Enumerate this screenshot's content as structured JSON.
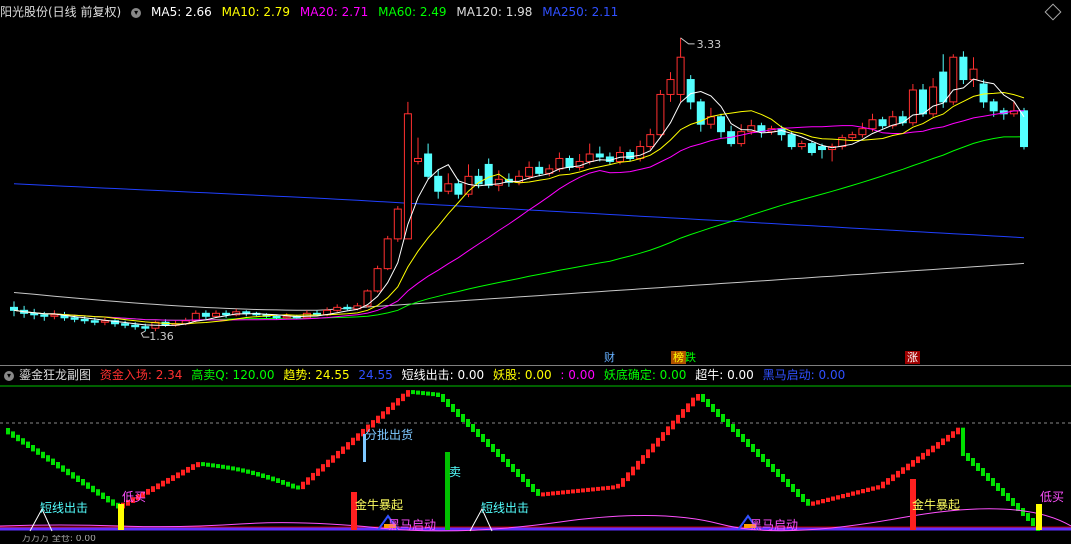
{
  "header": {
    "stock_name": "阳光股份(日线 前复权)",
    "ma": [
      {
        "label": "MA5: 2.66",
        "color": "#ffffff"
      },
      {
        "label": "MA10: 2.79",
        "color": "#ffff00"
      },
      {
        "label": "MA20: 2.71",
        "color": "#ff00ff"
      },
      {
        "label": "MA60: 2.49",
        "color": "#00ff00"
      },
      {
        "label": "MA120: 1.98",
        "color": "#dddddd"
      },
      {
        "label": "MA250: 2.11",
        "color": "#3050ff"
      }
    ]
  },
  "main": {
    "high_label": "3.33",
    "low_label": "1.36",
    "events": [
      {
        "label": "财",
        "color": "#66b0ff",
        "bg": "#000"
      },
      {
        "label": "榜",
        "color": "#ffff00",
        "bg": "#b05000"
      },
      {
        "label": "跌",
        "color": "#00ff00",
        "bg": "#000"
      },
      {
        "label": "涨",
        "color": "#ffffff",
        "bg": "#a00000"
      }
    ]
  },
  "sub": {
    "title": "鎏金狂龙副图",
    "items": [
      {
        "label": "资金入场: 2.34",
        "color": "#ff3030"
      },
      {
        "label": "高卖Q: 120.00",
        "color": "#00ff00"
      },
      {
        "label": "趋势: 24.55",
        "color": "#ffff00"
      },
      {
        "label": "24.55",
        "color": "#3050ff"
      },
      {
        "label": "短线出击: 0.00",
        "color": "#ffffff"
      },
      {
        "label": "妖股: 0.00",
        "color": "#ffff00"
      },
      {
        "label": ": 0.00",
        "color": "#ff00ff"
      },
      {
        "label": "妖底确定: 0.00",
        "color": "#00ff00"
      },
      {
        "label": "超牛: 0.00",
        "color": "#ffffff"
      },
      {
        "label": "黑马启动: 0.00",
        "color": "#3050ff"
      }
    ],
    "signals": {
      "short_out": "短线出击",
      "low_buy": "低买",
      "batch_sell": "分批出货",
      "sell": "卖",
      "bull_burst": "金牛暴起",
      "dark_horse": "黑马启动"
    }
  },
  "bottom": {
    "text": "万万万  全仓: 0.00"
  },
  "colors": {
    "up": "#ff3030",
    "down": "#54ffff",
    "ma5": "#ffffff",
    "ma10": "#ffff00",
    "ma20": "#ff00ff",
    "ma60": "#00ff00",
    "ma120": "#c8c8c8",
    "ma250": "#2040ff"
  },
  "chart_data": {
    "type": "candlestick",
    "ylim": [
      1.2,
      3.45
    ],
    "candles": [
      [
        1.52,
        1.5,
        1.56,
        1.46
      ],
      [
        1.5,
        1.48,
        1.53,
        1.45
      ],
      [
        1.48,
        1.47,
        1.51,
        1.44
      ],
      [
        1.47,
        1.46,
        1.49,
        1.43
      ],
      [
        1.46,
        1.47,
        1.5,
        1.44
      ],
      [
        1.47,
        1.45,
        1.49,
        1.43
      ],
      [
        1.45,
        1.44,
        1.47,
        1.42
      ],
      [
        1.44,
        1.43,
        1.46,
        1.41
      ],
      [
        1.43,
        1.42,
        1.45,
        1.4
      ],
      [
        1.42,
        1.43,
        1.45,
        1.4
      ],
      [
        1.43,
        1.41,
        1.44,
        1.39
      ],
      [
        1.41,
        1.4,
        1.43,
        1.38
      ],
      [
        1.4,
        1.39,
        1.42,
        1.37
      ],
      [
        1.39,
        1.38,
        1.41,
        1.36
      ],
      [
        1.38,
        1.42,
        1.43,
        1.36
      ],
      [
        1.42,
        1.4,
        1.44,
        1.39
      ],
      [
        1.4,
        1.41,
        1.43,
        1.39
      ],
      [
        1.41,
        1.43,
        1.45,
        1.4
      ],
      [
        1.43,
        1.48,
        1.5,
        1.42
      ],
      [
        1.48,
        1.46,
        1.5,
        1.44
      ],
      [
        1.46,
        1.48,
        1.5,
        1.45
      ],
      [
        1.48,
        1.47,
        1.5,
        1.45
      ],
      [
        1.47,
        1.49,
        1.51,
        1.46
      ],
      [
        1.49,
        1.48,
        1.5,
        1.46
      ],
      [
        1.48,
        1.47,
        1.49,
        1.46
      ],
      [
        1.47,
        1.46,
        1.48,
        1.45
      ],
      [
        1.46,
        1.45,
        1.47,
        1.44
      ],
      [
        1.45,
        1.46,
        1.48,
        1.44
      ],
      [
        1.46,
        1.45,
        1.47,
        1.44
      ],
      [
        1.45,
        1.48,
        1.5,
        1.45
      ],
      [
        1.48,
        1.47,
        1.5,
        1.46
      ],
      [
        1.47,
        1.5,
        1.52,
        1.46
      ],
      [
        1.5,
        1.52,
        1.54,
        1.49
      ],
      [
        1.52,
        1.51,
        1.54,
        1.5
      ],
      [
        1.51,
        1.53,
        1.55,
        1.5
      ],
      [
        1.53,
        1.63,
        1.64,
        1.52
      ],
      [
        1.63,
        1.78,
        1.8,
        1.62
      ],
      [
        1.78,
        1.98,
        2.0,
        1.77
      ],
      [
        1.98,
        2.18,
        2.2,
        1.96
      ],
      [
        1.98,
        2.82,
        2.9,
        1.98
      ],
      [
        2.5,
        2.52,
        2.66,
        2.48
      ],
      [
        2.55,
        2.4,
        2.62,
        2.38
      ],
      [
        2.4,
        2.3,
        2.45,
        2.25
      ],
      [
        2.3,
        2.35,
        2.42,
        2.28
      ],
      [
        2.35,
        2.28,
        2.38,
        2.25
      ],
      [
        2.28,
        2.4,
        2.48,
        2.26
      ],
      [
        2.4,
        2.35,
        2.45,
        2.32
      ],
      [
        2.48,
        2.34,
        2.52,
        2.32
      ],
      [
        2.34,
        2.38,
        2.44,
        2.3
      ],
      [
        2.38,
        2.36,
        2.42,
        2.33
      ],
      [
        2.36,
        2.4,
        2.44,
        2.34
      ],
      [
        2.4,
        2.46,
        2.5,
        2.38
      ],
      [
        2.46,
        2.42,
        2.5,
        2.4
      ],
      [
        2.42,
        2.45,
        2.48,
        2.4
      ],
      [
        2.45,
        2.52,
        2.56,
        2.43
      ],
      [
        2.52,
        2.46,
        2.54,
        2.44
      ],
      [
        2.46,
        2.5,
        2.55,
        2.44
      ],
      [
        2.5,
        2.55,
        2.62,
        2.48
      ],
      [
        2.55,
        2.53,
        2.6,
        2.5
      ],
      [
        2.53,
        2.5,
        2.56,
        2.48
      ],
      [
        2.5,
        2.56,
        2.6,
        2.48
      ],
      [
        2.56,
        2.52,
        2.58,
        2.5
      ],
      [
        2.52,
        2.6,
        2.64,
        2.5
      ],
      [
        2.6,
        2.68,
        2.72,
        2.58
      ],
      [
        2.68,
        2.95,
        2.98,
        2.66
      ],
      [
        2.95,
        3.05,
        3.1,
        2.9
      ],
      [
        2.95,
        3.2,
        3.33,
        2.9
      ],
      [
        3.05,
        2.9,
        3.08,
        2.85
      ],
      [
        2.9,
        2.75,
        2.92,
        2.7
      ],
      [
        2.75,
        2.8,
        2.86,
        2.72
      ],
      [
        2.8,
        2.7,
        2.82,
        2.66
      ],
      [
        2.7,
        2.62,
        2.74,
        2.6
      ],
      [
        2.62,
        2.7,
        2.75,
        2.6
      ],
      [
        2.7,
        2.74,
        2.78,
        2.68
      ],
      [
        2.74,
        2.7,
        2.76,
        2.66
      ],
      [
        2.7,
        2.72,
        2.74,
        2.68
      ],
      [
        2.72,
        2.68,
        2.74,
        2.64
      ],
      [
        2.68,
        2.6,
        2.7,
        2.58
      ],
      [
        2.6,
        2.62,
        2.64,
        2.58
      ],
      [
        2.62,
        2.56,
        2.64,
        2.54
      ],
      [
        2.6,
        2.58,
        2.62,
        2.52
      ],
      [
        2.58,
        2.6,
        2.62,
        2.5
      ],
      [
        2.6,
        2.66,
        2.68,
        2.58
      ],
      [
        2.66,
        2.68,
        2.7,
        2.64
      ],
      [
        2.68,
        2.72,
        2.76,
        2.66
      ],
      [
        2.72,
        2.78,
        2.82,
        2.7
      ],
      [
        2.78,
        2.74,
        2.8,
        2.72
      ],
      [
        2.74,
        2.8,
        2.84,
        2.72
      ],
      [
        2.8,
        2.76,
        2.84,
        2.74
      ],
      [
        2.76,
        2.98,
        3.02,
        2.74
      ],
      [
        2.98,
        2.82,
        3.02,
        2.8
      ],
      [
        2.82,
        3.0,
        3.06,
        2.8
      ],
      [
        3.1,
        2.9,
        3.22,
        2.86
      ],
      [
        2.9,
        3.2,
        3.22,
        2.88
      ],
      [
        3.2,
        3.05,
        3.24,
        3.02
      ],
      [
        3.05,
        3.12,
        3.2,
        3.0
      ],
      [
        3.02,
        2.9,
        3.05,
        2.86
      ],
      [
        2.9,
        2.84,
        2.92,
        2.8
      ],
      [
        2.84,
        2.82,
        2.86,
        2.78
      ],
      [
        2.82,
        2.84,
        2.9,
        2.8
      ],
      [
        2.84,
        2.6,
        2.86,
        2.58
      ]
    ]
  }
}
